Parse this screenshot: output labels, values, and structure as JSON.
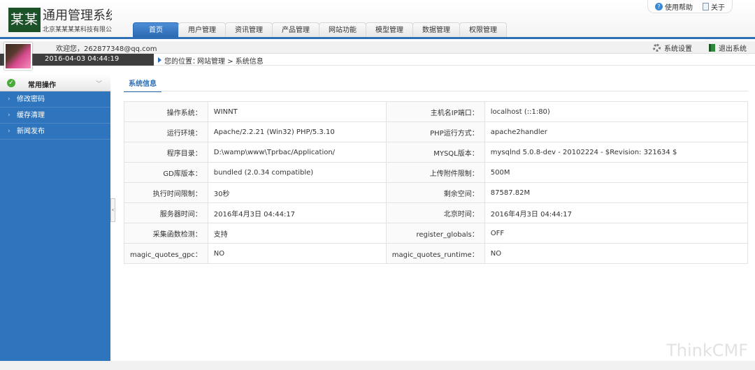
{
  "header": {
    "logo_mark": "某某",
    "title": "通用管理系统",
    "subtitle": "北京某某某某科技有限公司",
    "help_label": "使用帮助",
    "about_label": "关于"
  },
  "nav": {
    "tabs": [
      {
        "label": "首页",
        "active": true
      },
      {
        "label": "用户管理"
      },
      {
        "label": "资讯管理"
      },
      {
        "label": "产品管理"
      },
      {
        "label": "网站功能"
      },
      {
        "label": "模型管理"
      },
      {
        "label": "数据管理"
      },
      {
        "label": "权限管理"
      }
    ]
  },
  "userbar": {
    "welcome": "欢迎您，262877348@qq.com",
    "datetime": "2016-04-03 04:44:19",
    "settings_label": "系统设置",
    "logout_label": "退出系统"
  },
  "location": {
    "label": "您的位置：",
    "path": "网站管理 > 系统信息"
  },
  "sidebar": {
    "header": "常用操作",
    "items": [
      "修改密码",
      "缓存清理",
      "新闻发布"
    ]
  },
  "main": {
    "tab_label": "系统信息",
    "rows": [
      {
        "k1": "操作系统：",
        "v1": "WINNT",
        "k2": "主机名IP端口：",
        "v2": "localhost (::1:80)"
      },
      {
        "k1": "运行环境：",
        "v1": "Apache/2.2.21 (Win32) PHP/5.3.10",
        "k2": "PHP运行方式：",
        "v2": "apache2handler"
      },
      {
        "k1": "程序目录：",
        "v1": "D:\\wamp\\www\\Tprbac/Application/",
        "k2": "MYSQL版本：",
        "v2": "mysqlnd 5.0.8-dev - 20102224 - $Revision: 321634 $"
      },
      {
        "k1": "GD库版本：",
        "v1": "bundled (2.0.34 compatible)",
        "k2": "上传附件限制：",
        "v2": "500M"
      },
      {
        "k1": "执行时间限制：",
        "v1": "30秒",
        "k2": "剩余空间：",
        "v2": "87587.82M"
      },
      {
        "k1": "服务器时间：",
        "v1": "2016年4月3日 04:44:17",
        "k2": "北京时间：",
        "v2": "2016年4月3日 04:44:17"
      },
      {
        "k1": "采集函数检测：",
        "v1": "支持",
        "k2": "register_globals：",
        "v2": "OFF"
      },
      {
        "k1": "magic_quotes_gpc：",
        "v1": "NO",
        "k2": "magic_quotes_runtime：",
        "v2": "NO"
      }
    ]
  },
  "watermark": "ThinkCMF",
  "colors": {
    "accent": "#2e6fb5",
    "sidebar": "#2e75bd",
    "logo_bg": "#1c5227",
    "datebar": "#3d3d3d"
  },
  "icons": [
    "help-icon",
    "doc-icon",
    "gear-icon",
    "exit-icon",
    "check-icon",
    "chevron-down-icon",
    "chevron-right-icon",
    "chevron-left-icon"
  ]
}
